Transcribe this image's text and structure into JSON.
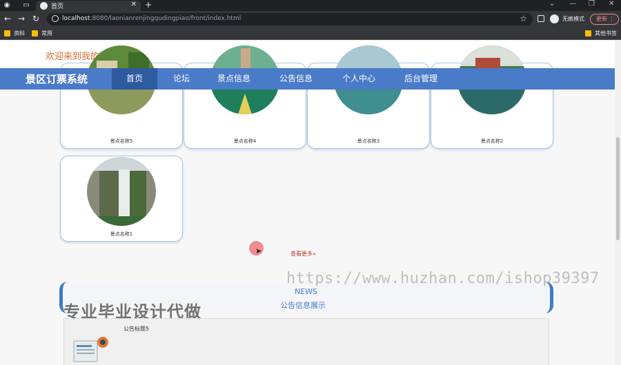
{
  "browser": {
    "tab_title": "首页",
    "url_host": "localhost",
    "url_rest": ":8080/laonianrenjingqudingpiao/front/index.html",
    "incognito_label": "无痕模式",
    "update_label": "更新",
    "bookmarks": [
      "资料",
      "常用"
    ],
    "other_bookmarks": "其他书签"
  },
  "site": {
    "welcome": "欢迎来到我的网站",
    "brand": "景区订票系统",
    "nav": [
      "首页",
      "论坛",
      "景点信息",
      "公告信息",
      "个人中心",
      "后台管理"
    ],
    "active_nav_index": 0
  },
  "spots": [
    {
      "name": "景点名称5"
    },
    {
      "name": "景点名称4"
    },
    {
      "name": "景点名称3"
    },
    {
      "name": "景点名称2"
    },
    {
      "name": "景点名称1"
    }
  ],
  "more_label": "查看更多»",
  "news": {
    "en": "NEWS",
    "cn": "公告信息展示",
    "items": [
      {
        "title": "公告标题5"
      }
    ]
  },
  "promo_text": "专业毕业设计代做",
  "watermark": "https://www.huzhan.com/ishop39397",
  "colors": {
    "nav_bg": "#4a7bc8",
    "nav_active": "#2e5aa0",
    "welcome": "#e06a2a"
  }
}
